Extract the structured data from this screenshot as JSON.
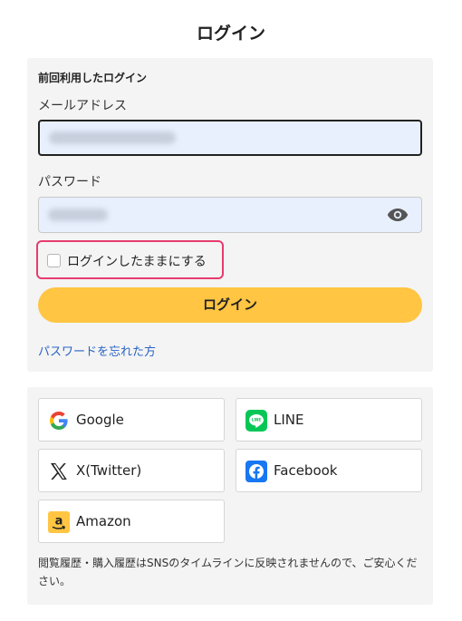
{
  "page": {
    "title": "ログイン"
  },
  "login": {
    "heading": "前回利用したログイン",
    "email": {
      "label": "メールアドレス",
      "value": ""
    },
    "password": {
      "label": "パスワード",
      "value": ""
    },
    "remember_label": "ログインしたままにする",
    "remember_checked": false,
    "submit_label": "ログイン",
    "forgot_link": "パスワードを忘れた方"
  },
  "sns": {
    "buttons": [
      {
        "label": "Google",
        "icon": "google-icon"
      },
      {
        "label": "LINE",
        "icon": "line-icon"
      },
      {
        "label": "X(Twitter)",
        "icon": "x-icon"
      },
      {
        "label": "Facebook",
        "icon": "facebook-icon"
      },
      {
        "label": "Amazon",
        "icon": "amazon-icon"
      }
    ],
    "notice": "閲覧履歴・購入履歴はSNSのタイムラインに反映されませんので、ご安心ください。"
  },
  "colors": {
    "accent_button": "#ffc543",
    "highlight_border": "#e63c6e",
    "link": "#2a64c5",
    "line_green": "#06c755",
    "facebook_blue": "#1877f2"
  }
}
